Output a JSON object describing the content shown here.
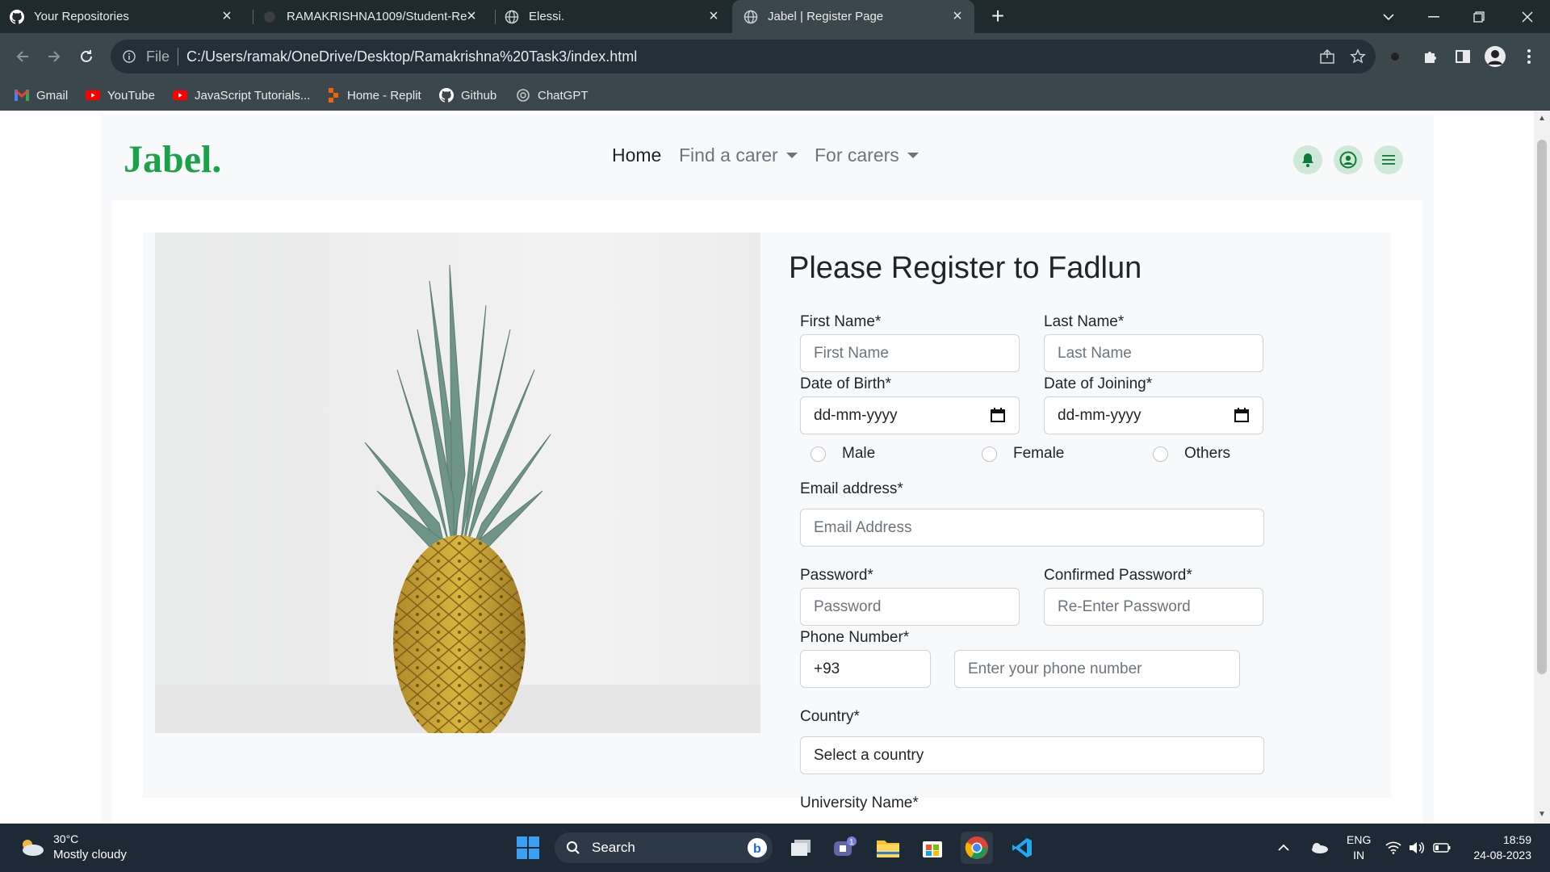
{
  "browser": {
    "tabs": [
      {
        "title": "Your Repositories",
        "icon": "github-icon",
        "active": false
      },
      {
        "title": "RAMAKRISHNA1009/Student-Re",
        "icon": "github-icon",
        "active": false
      },
      {
        "title": "Elessi.",
        "icon": "globe-icon",
        "active": false
      },
      {
        "title": "Jabel | Register Page",
        "icon": "globe-icon",
        "active": true
      }
    ],
    "address": {
      "scheme": "File",
      "url": "C:/Users/ramak/OneDrive/Desktop/Ramakrishna%20Task3/index.html"
    },
    "bookmarks": [
      {
        "label": "Gmail",
        "icon": "gmail-icon"
      },
      {
        "label": "YouTube",
        "icon": "youtube-icon"
      },
      {
        "label": "JavaScript Tutorials...",
        "icon": "youtube-icon"
      },
      {
        "label": "Home - Replit",
        "icon": "replit-icon"
      },
      {
        "label": "Github",
        "icon": "github-icon"
      },
      {
        "label": "ChatGPT",
        "icon": "chatgpt-icon"
      }
    ]
  },
  "site": {
    "brand": "Jabel.",
    "brand_color": "#1aa14a",
    "nav": {
      "home": "Home",
      "find_carer": "Find a carer",
      "for_carers": "For carers"
    }
  },
  "form": {
    "title": "Please Register to Fadlun",
    "first_name": {
      "label": "First Name*",
      "placeholder": "First Name"
    },
    "last_name": {
      "label": "Last Name*",
      "placeholder": "Last Name"
    },
    "dob": {
      "label": "Date of Birth*",
      "value": "dd-mm-yyyy"
    },
    "doj": {
      "label": "Date of Joining*",
      "value": "dd-mm-yyyy"
    },
    "gender": [
      "Male",
      "Female",
      "Others"
    ],
    "email": {
      "label": "Email address*",
      "placeholder": "Email Address"
    },
    "password": {
      "label": "Password*",
      "placeholder": "Password"
    },
    "confirm_password": {
      "label": "Confirmed Password*",
      "placeholder": "Re-Enter Password"
    },
    "phone": {
      "label": "Phone Number*",
      "code": "+93",
      "placeholder": "Enter your phone number"
    },
    "country": {
      "label": "Country*",
      "value": "Select a country"
    },
    "university": {
      "label": "University Name*"
    }
  },
  "taskbar": {
    "weather": {
      "temp": "30°C",
      "desc": "Mostly cloudy"
    },
    "search": "Search",
    "lang": {
      "top": "ENG",
      "bottom": "IN"
    },
    "clock": {
      "time": "18:59",
      "date": "24-08-2023"
    },
    "chat_badge": "1"
  }
}
